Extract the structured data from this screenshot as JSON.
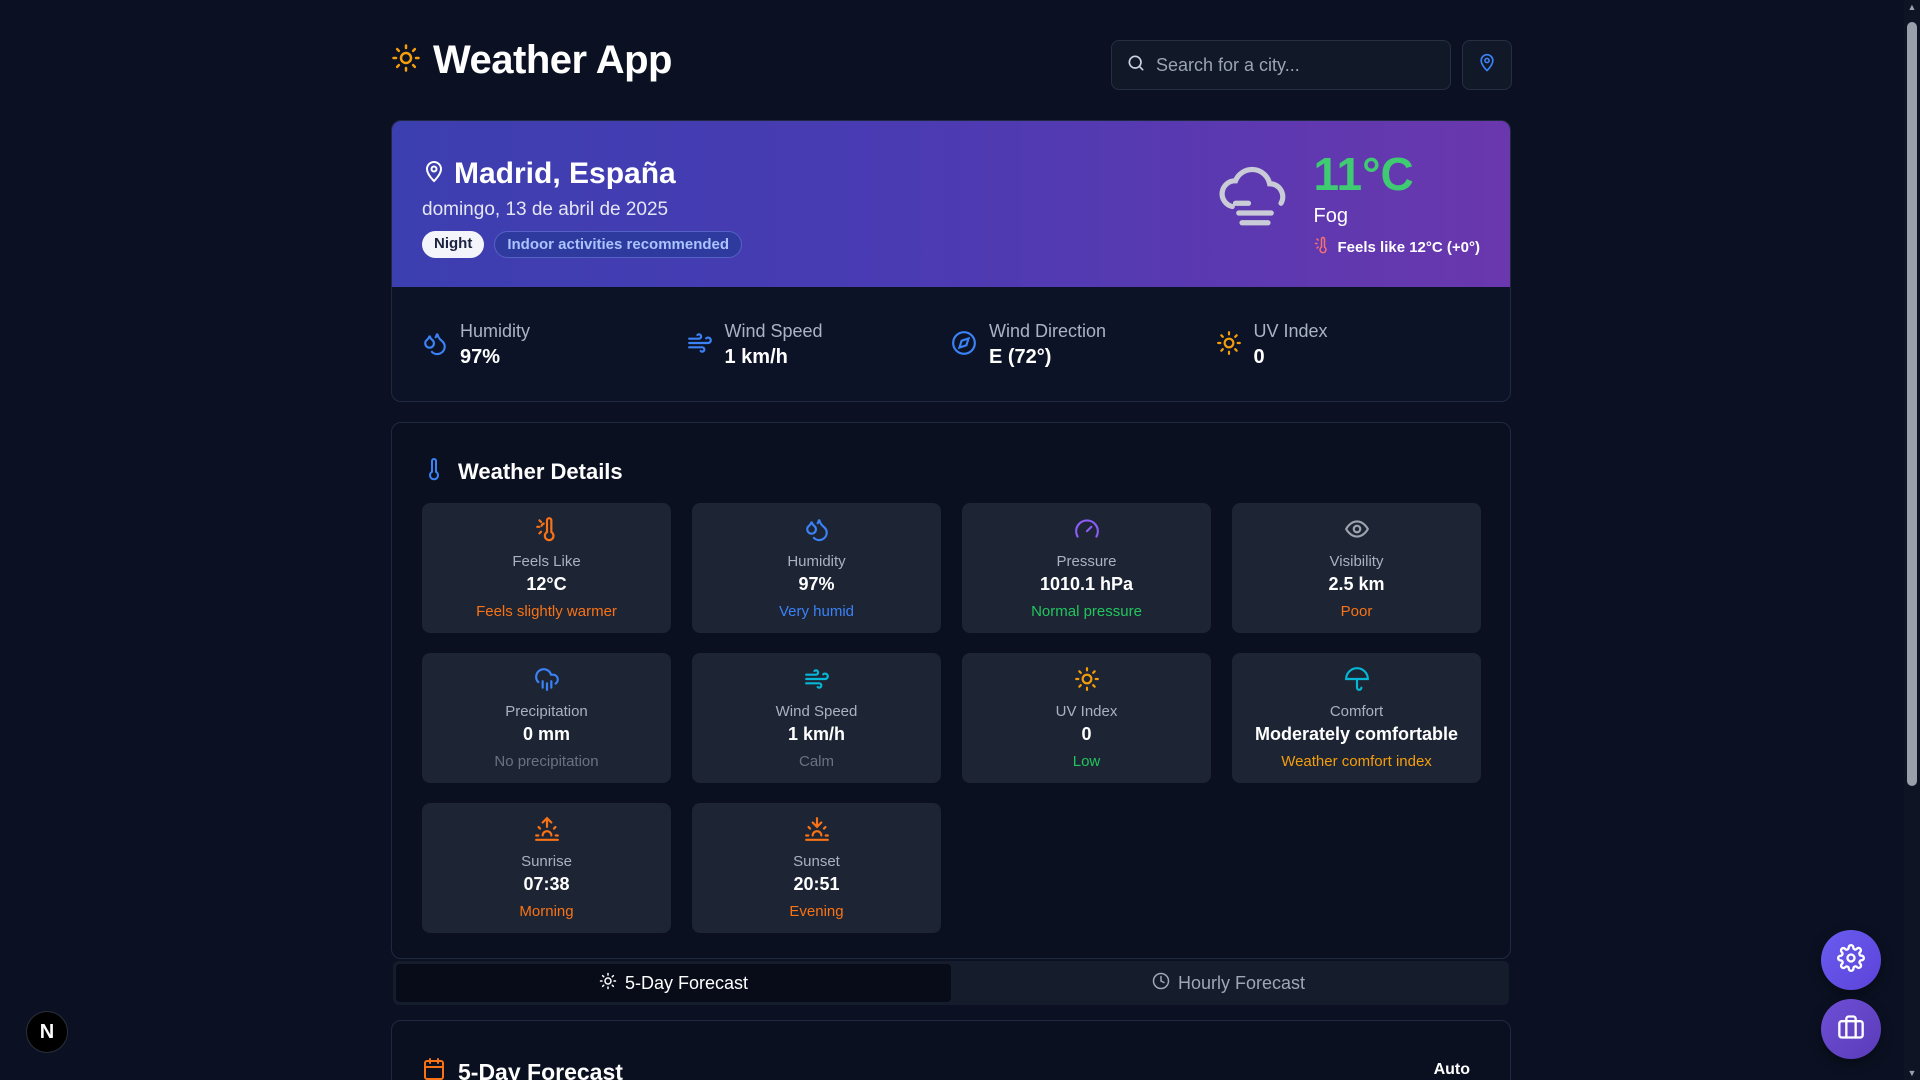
{
  "app": {
    "title": "Weather App"
  },
  "search": {
    "placeholder": "Search for a city..."
  },
  "current": {
    "city": "Madrid, España",
    "date": "domingo, 13 de abril de 2025",
    "badges": [
      "Night",
      "Indoor activities recommended"
    ],
    "temperature": "11°C",
    "condition": "Fog",
    "feels_like": "Feels like 12°C (+0°)"
  },
  "stats": [
    {
      "label": "Humidity",
      "value": "97%",
      "icon": "humidity-icon"
    },
    {
      "label": "Wind Speed",
      "value": "1 km/h",
      "icon": "wind-icon"
    },
    {
      "label": "Wind Direction",
      "value": "E (72°)",
      "icon": "compass-icon"
    },
    {
      "label": "UV Index",
      "value": "0",
      "icon": "sun-icon"
    }
  ],
  "details": {
    "title": "Weather Details",
    "tiles": [
      {
        "label": "Feels Like",
        "value": "12°C",
        "note": "Feels slightly warmer",
        "icon": "thermometer-sun-icon"
      },
      {
        "label": "Humidity",
        "value": "97%",
        "note": "Very humid",
        "icon": "droplets-icon"
      },
      {
        "label": "Pressure",
        "value": "1010.1 hPa",
        "note": "Normal pressure",
        "icon": "gauge-icon"
      },
      {
        "label": "Visibility",
        "value": "2.5 km",
        "note": "Poor",
        "icon": "eye-icon"
      },
      {
        "label": "Precipitation",
        "value": "0 mm",
        "note": "No precipitation",
        "icon": "cloud-rain-icon"
      },
      {
        "label": "Wind Speed",
        "value": "1 km/h",
        "note": "Calm",
        "icon": "wind-icon"
      },
      {
        "label": "UV Index",
        "value": "0",
        "note": "Low",
        "icon": "sun-icon"
      },
      {
        "label": "Comfort",
        "value": "Moderately comfortable",
        "note": "Weather comfort index",
        "icon": "umbrella-icon"
      },
      {
        "label": "Sunrise",
        "value": "07:38",
        "note": "Morning",
        "icon": "sunrise-icon"
      },
      {
        "label": "Sunset",
        "value": "20:51",
        "note": "Evening",
        "icon": "sunset-icon"
      }
    ]
  },
  "tabs": [
    {
      "label": "5-Day Forecast",
      "active": true
    },
    {
      "label": "Hourly Forecast",
      "active": false
    }
  ],
  "forecast": {
    "title": "5-Day Forecast",
    "unit_mode": "Auto"
  },
  "nextjs_badge": "N",
  "colors": {
    "background": "#0b1122",
    "hero_start": "#3c3fb0",
    "hero_end": "#6a37ae",
    "temperature": "#3ecb71",
    "accent_blue": "#3b82f6",
    "accent_orange": "#f97316",
    "accent_green": "#22c55e",
    "accent_amber": "#f59e0b"
  }
}
